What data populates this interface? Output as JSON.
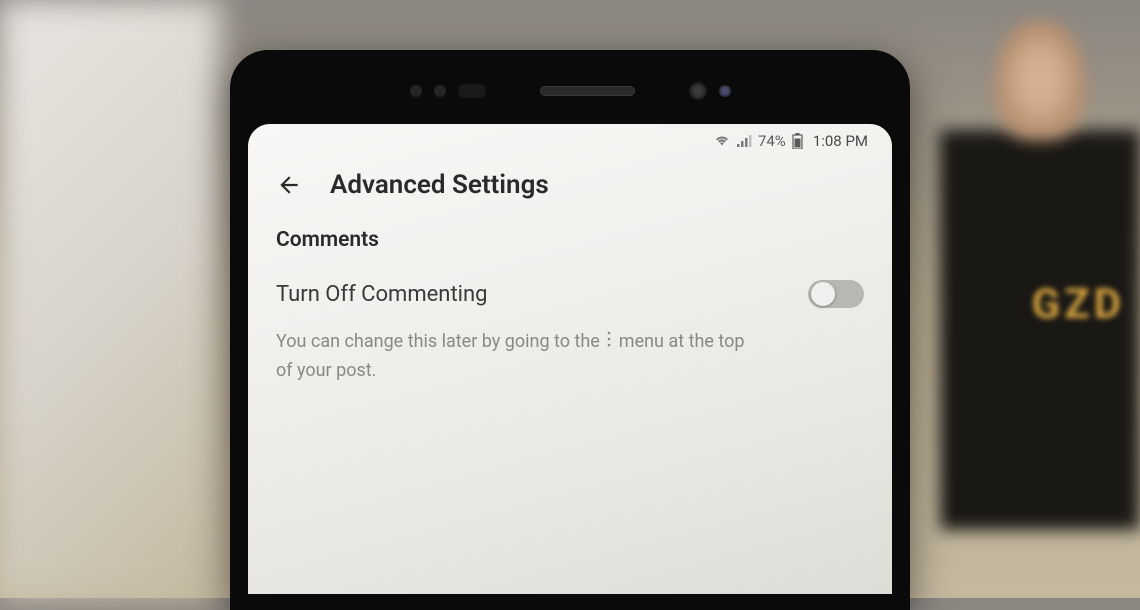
{
  "status_bar": {
    "battery_percent": "74%",
    "time": "1:08 PM"
  },
  "header": {
    "title": "Advanced Settings"
  },
  "content": {
    "section_title": "Comments",
    "setting": {
      "label": "Turn Off Commenting",
      "toggle_state": "off",
      "description_part1": "You can change this later by going to the",
      "description_part2": "menu at the top of your post."
    }
  },
  "background": {
    "box_text": "GZD"
  }
}
